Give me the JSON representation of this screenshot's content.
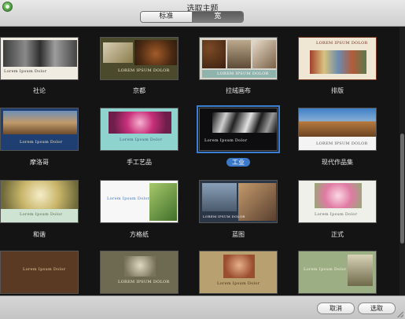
{
  "window": {
    "title": "选取主题"
  },
  "tabs": [
    {
      "label": "标准"
    },
    {
      "label": "宽"
    }
  ],
  "themes": [
    {
      "name": "社论",
      "placeholder": "Lorem Ipsum Dolor"
    },
    {
      "name": "京都",
      "placeholder": "LOREM IPSUM DOLOR"
    },
    {
      "name": "拉绒画布",
      "placeholder": "LOREM IPSUM DOLOR"
    },
    {
      "name": "排版",
      "placeholder": "LOREM IPSUM DOLOR"
    },
    {
      "name": "摩洛哥",
      "placeholder": "Lorem Ipsum Dolor"
    },
    {
      "name": "手工艺品",
      "placeholder": "Lorem Ipsum Dolor"
    },
    {
      "name": "工业",
      "placeholder": "Lorem Ipsum Dolor"
    },
    {
      "name": "现代作品集",
      "placeholder": "LOREM IPSUM DOLOR"
    },
    {
      "name": "和谐",
      "placeholder": "Lorem Ipsum Dolor"
    },
    {
      "name": "方格纸",
      "placeholder": "Lorem Ipsum Dolor"
    },
    {
      "name": "蓝图",
      "placeholder": "LOREM IPSUM DOLOR"
    },
    {
      "name": "正式",
      "placeholder": "Lorem Ipsum Dolor"
    },
    {
      "name": "",
      "placeholder": "Lorem Ipsum Dolor"
    },
    {
      "name": "",
      "placeholder": "LOREM IPSUM DOLOR"
    },
    {
      "name": "",
      "placeholder": "Lorem Ipsum Dolor"
    },
    {
      "name": "",
      "placeholder": "Lorem Ipsum Dolor"
    }
  ],
  "buttons": {
    "cancel": "取消",
    "choose": "选取"
  },
  "colors": {
    "selection": "#3b78c8"
  }
}
